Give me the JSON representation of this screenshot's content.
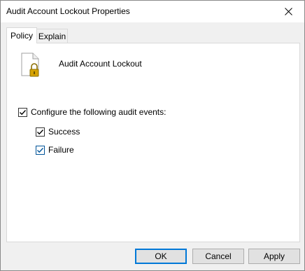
{
  "window": {
    "title": "Audit Account Lockout Properties"
  },
  "tabs": [
    {
      "label": "Policy",
      "active": true
    },
    {
      "label": "Explain",
      "active": false
    }
  ],
  "policy": {
    "name": "Audit Account Lockout",
    "icon": "document-lock-icon"
  },
  "options": {
    "configure": {
      "label": "Configure the following audit events:",
      "checked": true
    },
    "success": {
      "label": "Success",
      "checked": true
    },
    "failure": {
      "label": "Failure",
      "checked": true
    }
  },
  "buttons": {
    "ok": "OK",
    "cancel": "Cancel",
    "apply": "Apply"
  },
  "colors": {
    "focus": "#0078d7",
    "lock": "#d6a200"
  }
}
